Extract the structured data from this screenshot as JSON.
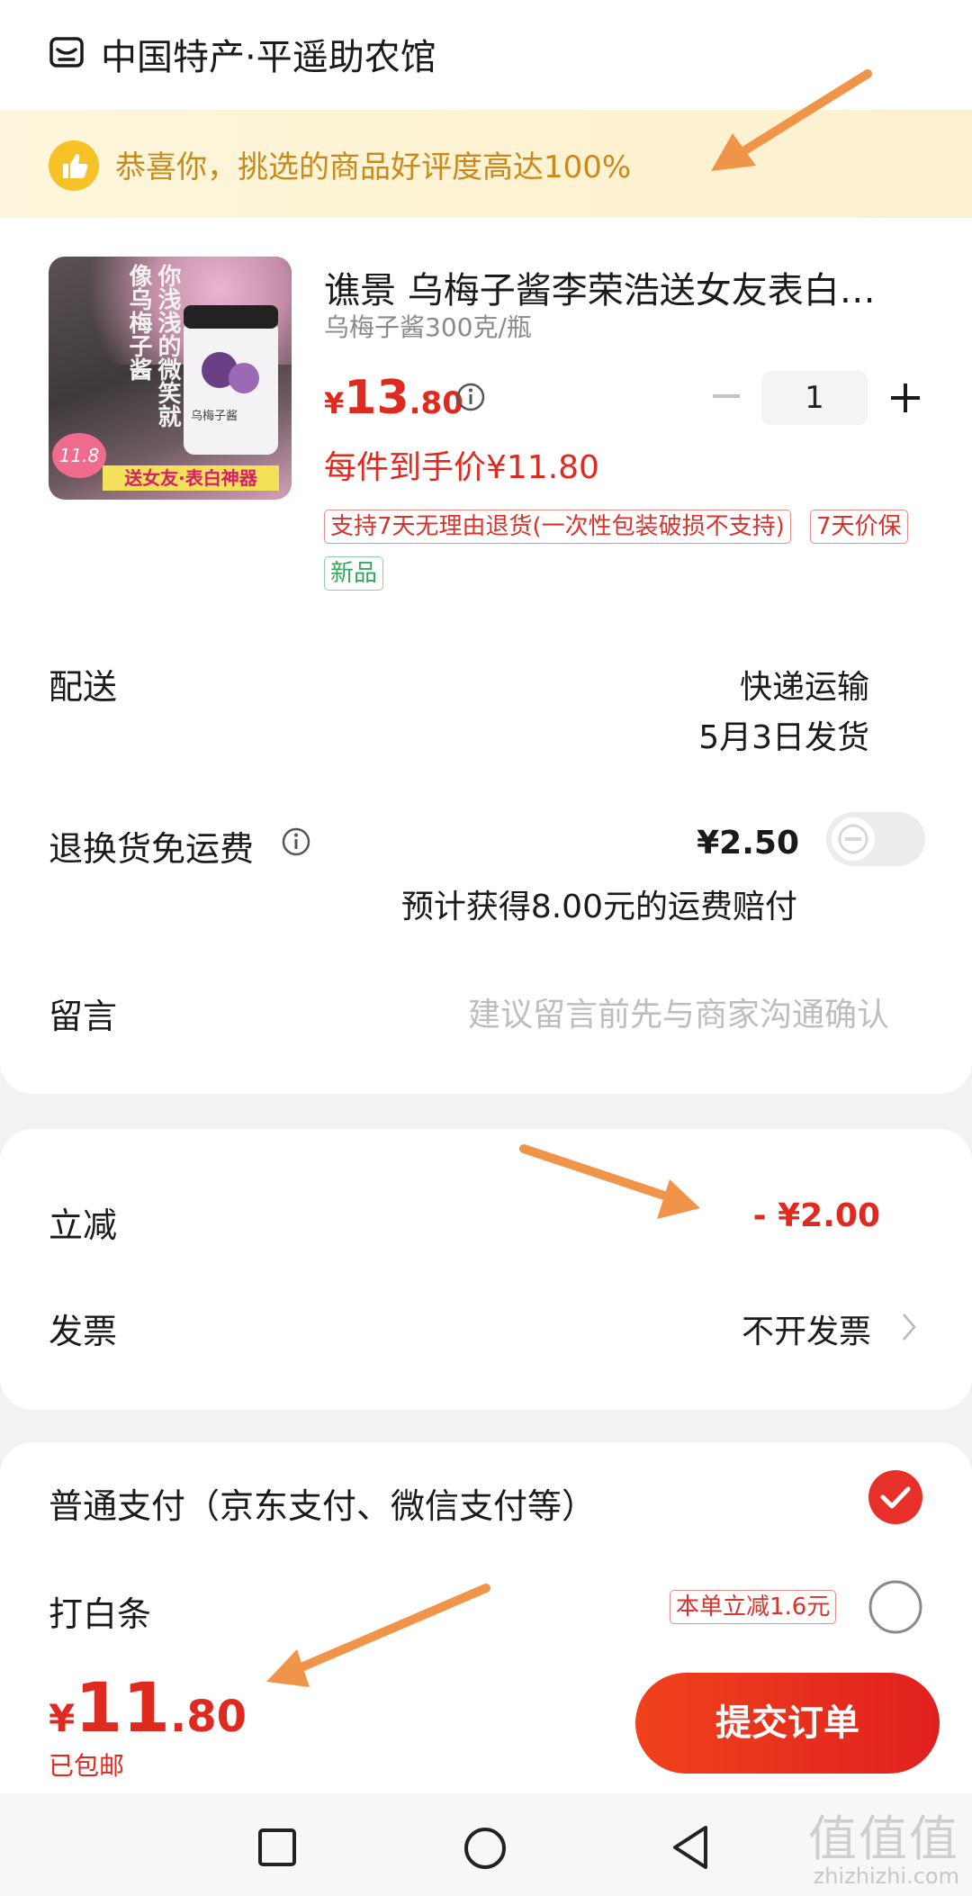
{
  "shop": {
    "name": "中国特产·平遥助农馆"
  },
  "banner": {
    "text": "恭喜你，挑选的商品好评度高达100%"
  },
  "product": {
    "thumb_text": "你浅浅的微笑就像乌梅子酱",
    "thumb_badge": "11.8",
    "thumb_footer": "送女友·表白神器",
    "jar_label": "乌梅子酱",
    "title": "谯景 乌梅子酱李荣浩送女友表白神…",
    "spec": "乌梅子酱300克/瓶",
    "price_symbol": "¥",
    "price_int": "13",
    "price_dec": ".80",
    "unit_price": "每件到手价¥11.80",
    "quantity": "1",
    "tags": [
      "支持7天无理由退货(一次性包装破损不支持)",
      "7天价保",
      "新品"
    ]
  },
  "delivery": {
    "label": "配送",
    "method": "快递运输",
    "ship_date": "5月3日发货"
  },
  "return_shipping": {
    "label": "退换货免运费",
    "fee": "¥2.50",
    "note": "预计获得8.00元的运费赔付",
    "enabled": false
  },
  "message": {
    "label": "留言",
    "placeholder": "建议留言前先与商家沟通确认"
  },
  "discount": {
    "label": "立减",
    "value": "- ¥2.00"
  },
  "invoice": {
    "label": "发票",
    "value": "不开发票"
  },
  "payment": {
    "option1": "普通支付（京东支付、微信支付等）",
    "option1_selected": true,
    "option2": "打白条",
    "option2_badge": "本单立减1.6元",
    "option2_selected": false
  },
  "footer": {
    "total_symbol": "¥",
    "total_int": "11",
    "total_dec": ".80",
    "free_shipping": "已包邮",
    "submit": "提交订单"
  },
  "watermark": {
    "big": "值值值",
    "small": "zhizhizhi.com"
  },
  "colors": {
    "accent": "#e0291f",
    "annotation_arrow": "#f0944a",
    "banner_text": "#c98a1b"
  }
}
